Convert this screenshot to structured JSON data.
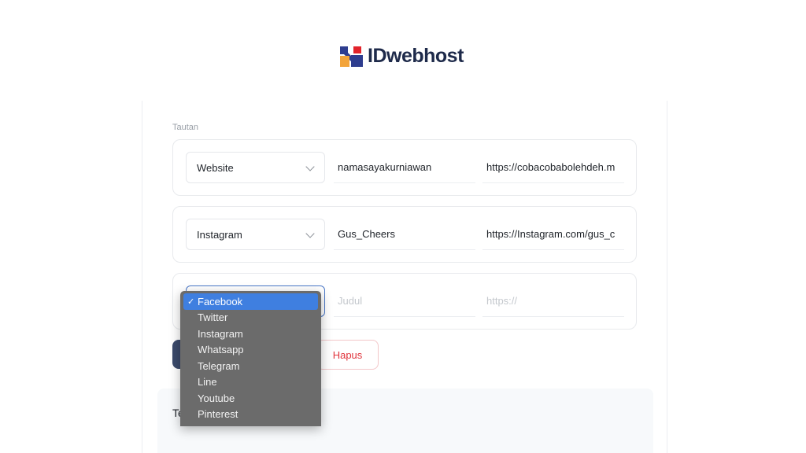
{
  "brand": {
    "name": "IDwebhost"
  },
  "form": {
    "section_label": "Tautan",
    "links": [
      {
        "type": "Website",
        "title": "namasayakurniawan",
        "url": "https://cobacobabolehdeh.m"
      },
      {
        "type": "Instagram",
        "title": "Gus_Cheers",
        "url": "https://Instagram.com/gus_c"
      },
      {
        "type": "Facebook",
        "title": "",
        "url": ""
      }
    ],
    "title_placeholder": "Judul",
    "url_placeholder": "https://",
    "delete_label": "Hapus",
    "next_section_title": "Te"
  },
  "dropdown": {
    "selected": "Facebook",
    "check_glyph": "✓",
    "options": [
      "Facebook",
      "Twitter",
      "Instagram",
      "Whatsapp",
      "Telegram",
      "Line",
      "Youtube",
      "Pinterest"
    ]
  }
}
